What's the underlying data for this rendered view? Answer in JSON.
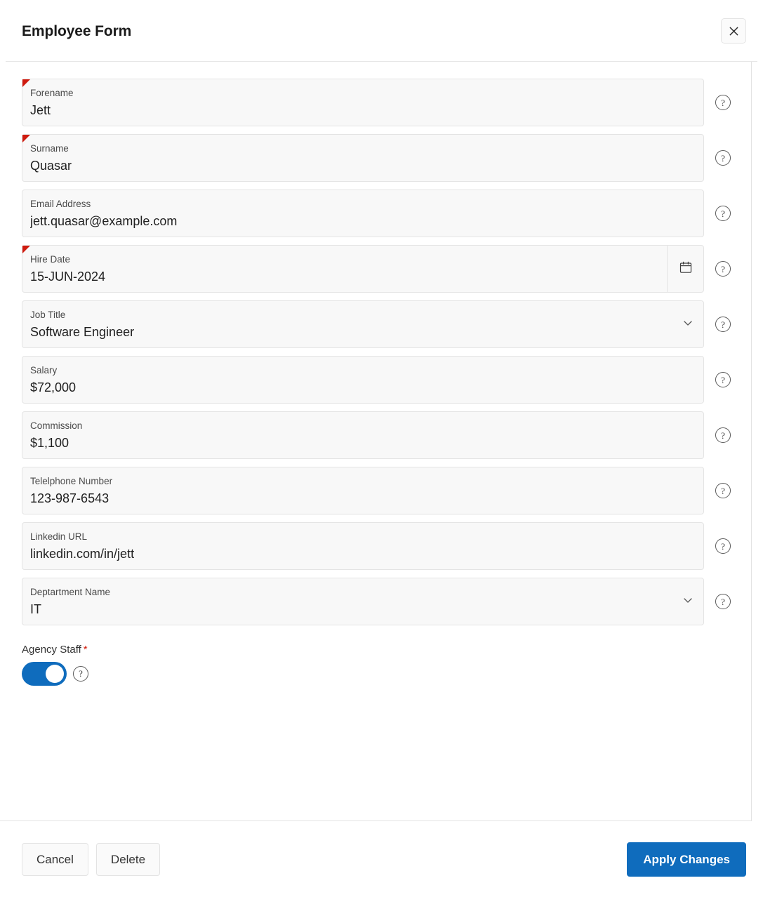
{
  "header": {
    "title": "Employee Form",
    "close_label": "Close",
    "close_icon": "close-icon"
  },
  "form": {
    "fields": [
      {
        "name": "forename",
        "label": "Forename",
        "value": "Jett",
        "required": true,
        "control": "text",
        "help": "?"
      },
      {
        "name": "surname",
        "label": "Surname",
        "value": "Quasar",
        "required": true,
        "control": "text",
        "help": "?"
      },
      {
        "name": "email-address",
        "label": "Email Address",
        "value": "jett.quasar@example.com",
        "required": false,
        "control": "text",
        "help": "?"
      },
      {
        "name": "hire-date",
        "label": "Hire Date",
        "value": "15-JUN-2024",
        "required": true,
        "control": "date",
        "trigger_icon": "calendar-icon",
        "help": "?"
      },
      {
        "name": "job-title",
        "label": "Job Title",
        "value": "Software Engineer",
        "required": false,
        "control": "select",
        "trigger_icon": "chevron-down-icon",
        "help": "?"
      },
      {
        "name": "salary",
        "label": "Salary",
        "value": "$72,000",
        "required": false,
        "control": "text",
        "help": "?"
      },
      {
        "name": "commission",
        "label": "Commission",
        "value": "$1,100",
        "required": false,
        "control": "text",
        "help": "?"
      },
      {
        "name": "telephone-number",
        "label": "Telelphone Number",
        "value": "123-987-6543",
        "required": false,
        "control": "text",
        "help": "?"
      },
      {
        "name": "linkedin-url",
        "label": "Linkedin URL",
        "value": "linkedin.com/in/jett",
        "required": false,
        "control": "text",
        "help": "?"
      },
      {
        "name": "department-name",
        "label": "Deptartment Name",
        "value": "IT",
        "required": false,
        "control": "select",
        "trigger_icon": "chevron-down-icon",
        "help": "?"
      }
    ],
    "switch_field": {
      "name": "agency-staff",
      "label": "Agency Staff",
      "required_marker": "*",
      "state": "on",
      "help": "?"
    }
  },
  "footer": {
    "cancel_label": "Cancel",
    "delete_label": "Delete",
    "apply_label": "Apply Changes"
  },
  "colors": {
    "accent": "#0f6cbd",
    "required_flag": "#cf1b0f",
    "required_asterisk": "#d21b0c",
    "field_bg": "#f8f8f8",
    "field_border": "#e4e4e4",
    "text_primary": "#1f1f1f",
    "text_label": "#4a4a4a"
  }
}
